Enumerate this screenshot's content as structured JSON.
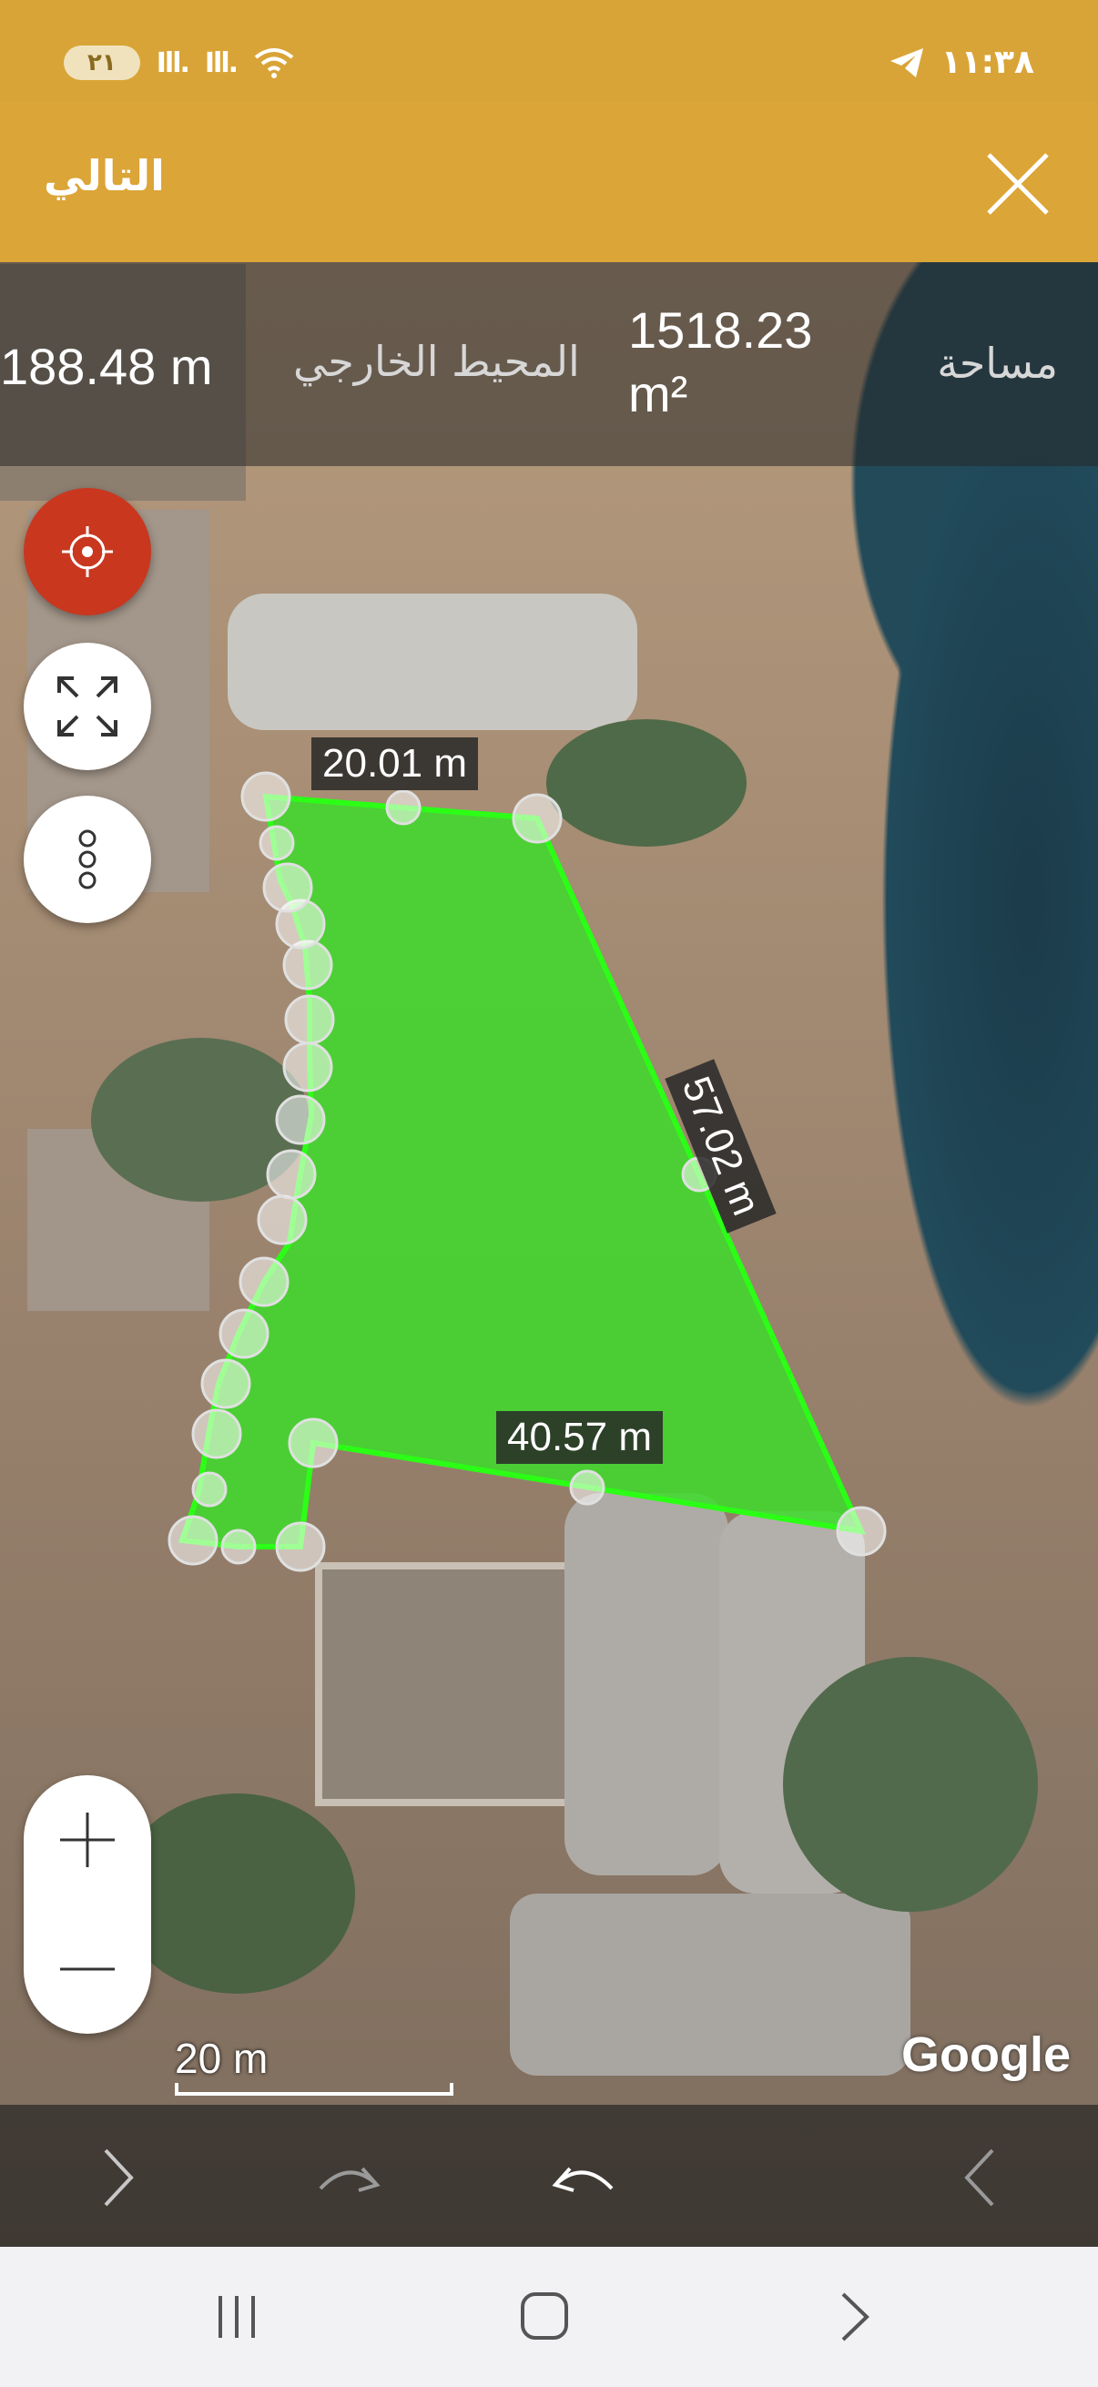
{
  "status_bar": {
    "time": "١١:٣٨",
    "notification_badge": "٢١",
    "signal_1": "Ill.",
    "signal_2": "Ill."
  },
  "app_bar": {
    "next_label": "التالي"
  },
  "measurements": {
    "perimeter_value": "188.48 m",
    "perimeter_label": "المحيط الخارجي",
    "area_value": "1518.23 m²",
    "area_label": "مساحة"
  },
  "segments": {
    "top": "20.01 m",
    "right": "57.02 m",
    "bottom": "40.57 m"
  },
  "map": {
    "scale_label": "20 m",
    "attribution": "Google",
    "polygon_color": "#3ddc2a"
  },
  "colors": {
    "accent": "#dba537",
    "locate": "#c9371f"
  }
}
